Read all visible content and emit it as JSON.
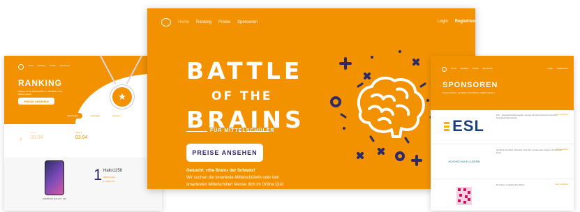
{
  "left": {
    "nav": {
      "items": [
        "Home",
        "Ranking",
        "Preise",
        "Sponsoren"
      ],
      "login": "Login",
      "register": "Registrieren"
    },
    "title": "RANKING",
    "subtitle": "Schaue dir die Mittelschüler an, die Battle of the Brains spielen.",
    "button": "PREISE ANSEHEN",
    "tabs": [
      "Wöchentlich",
      "Monatlich",
      "Gesamt"
    ],
    "cards": [
      {
        "label": "Preis 1",
        "date": "30.04"
      },
      {
        "label": "Preis 2",
        "date": "03.04"
      }
    ],
    "prize": {
      "name": "SAMSUNG GALAXY S10"
    },
    "user": {
      "rank": "1",
      "name": "Hallo1256",
      "line1": "3600 Punkte",
      "line2": "1. 18:00 Uhr"
    }
  },
  "center": {
    "nav": {
      "items": [
        "Home",
        "Ranking",
        "Preise",
        "Sponsoren"
      ],
      "login": "Login",
      "register": "Registrien"
    },
    "title_line1": "BATTLE",
    "title_line2": "OF THE",
    "title_line3": "BRAINS",
    "tagline": "FÜR MITTELSCHÜLER",
    "cta": "PREISE ANSEHEN",
    "paragraph_heading": "Gesucht: «the Brain» der Schweiz!",
    "paragraph": "Wir suchen die smarteste Mittelschülerin oder den smartesten Mittelschüler! Messe dich im Online Quiz"
  },
  "right": {
    "nav": {
      "items": [
        "Home",
        "Ranking",
        "Preise",
        "Sponsoren"
      ],
      "login": "Login",
      "register": "Registrieren"
    },
    "title": "SPONSOREN",
    "subtitle": "Unsere Partner, die Battle of the Brains möglich machen.",
    "sponsors": [
      {
        "logo": "ESL",
        "more": "mehr erfahren",
        "text": "ESL – Sprachaufenthalte begleiten seit über 25 Jahren Menschen bei ihrem Sprachaufenthalt weltweit."
      },
      {
        "logo": "HOCHSCHULE LUZERN",
        "more": "mehr erfahren",
        "text": "Technik & Architektur, Wirtschaft, Informatik, Soziale Arbeit, Design & Kunst sowie Musik."
      },
      {
        "logo": "",
        "more": "mehr erfahren",
        "text": "Ein Partner von Battle of the Brains."
      }
    ]
  },
  "colors": {
    "accent": "#f39200",
    "navy": "#2d2a6b",
    "white": "#ffffff"
  }
}
